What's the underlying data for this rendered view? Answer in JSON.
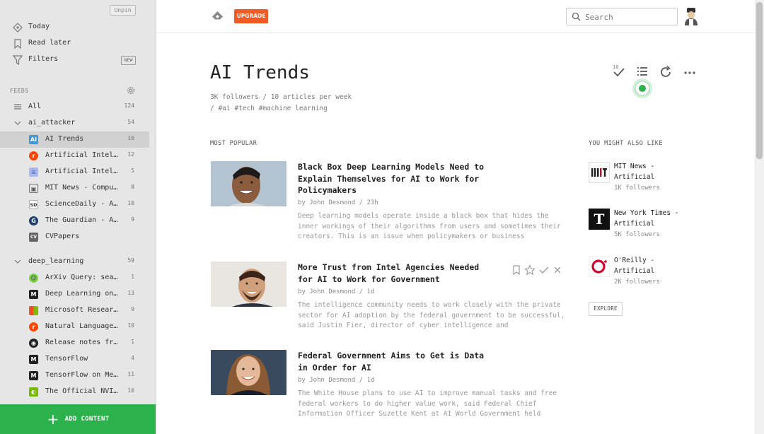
{
  "sidebar": {
    "unpin_label": "Unpin",
    "nav": [
      {
        "label": "Today",
        "icon": "today-icon"
      },
      {
        "label": "Read later",
        "icon": "bookmark-icon"
      },
      {
        "label": "Filters",
        "icon": "filter-icon",
        "badge": "NEW"
      }
    ],
    "feeds_label": "FEEDS",
    "all": {
      "label": "All",
      "count": "124"
    },
    "groups": [
      {
        "label": "ai_attacker",
        "count": "54",
        "items": [
          {
            "label": "AI Trends",
            "count": "10",
            "icon_color": "#3b9ad9",
            "icon_text": "AI",
            "active": true
          },
          {
            "label": "Artificial Intel…",
            "count": "12",
            "icon_color": "#ff4500",
            "icon_text": "r"
          },
          {
            "label": "Artificial Intel…",
            "count": "5",
            "icon_color": "#a9b6f5",
            "icon_text": "≡"
          },
          {
            "label": "MIT News - Compu…",
            "count": "8",
            "icon_color": "#888888",
            "icon_text": "▣"
          },
          {
            "label": "ScienceDaily - A…",
            "count": "10",
            "icon_color": "#ffffff",
            "icon_text": "SD"
          },
          {
            "label": "The Guardian - A…",
            "count": "9",
            "icon_color": "#1c3e6e",
            "icon_text": "G"
          },
          {
            "label": "CVPapers",
            "count": "",
            "icon_color": "#666666",
            "icon_text": "CV"
          }
        ]
      },
      {
        "label": "deep_learning",
        "count": "59",
        "items": [
          {
            "label": "ArXiv Query: sea…",
            "count": "1",
            "icon_color": "#7bd44a",
            "icon_text": "☺"
          },
          {
            "label": "Deep Learning on…",
            "count": "13",
            "icon_color": "#222222",
            "icon_text": "M"
          },
          {
            "label": "Microsoft Resear…",
            "count": "9",
            "icon_color": "#f25022",
            "icon_text": "▦"
          },
          {
            "label": "Natural Language…",
            "count": "10",
            "icon_color": "#ff4500",
            "icon_text": "r"
          },
          {
            "label": "Release notes fr…",
            "count": "1",
            "icon_color": "#222222",
            "icon_text": "◉"
          },
          {
            "label": "TensorFlow",
            "count": "4",
            "icon_color": "#222222",
            "icon_text": "M"
          },
          {
            "label": "TensorFlow on Me…",
            "count": "11",
            "icon_color": "#222222",
            "icon_text": "M"
          },
          {
            "label": "The Official NVI…",
            "count": "10",
            "icon_color": "#76b900",
            "icon_text": "◐"
          }
        ]
      }
    ],
    "add_content_label": "ADD CONTENT"
  },
  "header": {
    "upgrade_label": "UPGRADE",
    "search_placeholder": "Search"
  },
  "feed": {
    "title": "AI Trends",
    "stats": "3K followers / 10 articles per week",
    "tags": " / #ai #tech #machine learning",
    "mark_read_count": "10"
  },
  "most_popular": {
    "label": "MOST POPULAR",
    "articles": [
      {
        "title": "Black Box Deep Learning Models Need to Explain Themselves for AI to Work for Policymakers",
        "byline": "by John Desmond / 23h",
        "summary": "Deep learning models operate inside a black box that hides the inner workings of their algorithms from users and sometimes their creators. This is an issue when policymakers or business"
      },
      {
        "title": "More Trust from Intel Agencies Needed for AI to Work for Government",
        "byline": "by John Desmond / 1d",
        "summary": "The intelligence community needs to work closely with the private sector for AI adoption by the federal government to be successful, said Justin Fier, director of cyber intelligence and"
      },
      {
        "title": "Federal Government Aims to Get is Data in Order for AI",
        "byline": "by John Desmond / 1d",
        "summary": "The White House plans to use AI to improve manual tasks and free federal workers to do higher value work, said Federal Chief Information Officer Suzette Kent at AI World Government held"
      }
    ]
  },
  "suggestions": {
    "label": "YOU MIGHT ALSO LIKE",
    "items": [
      {
        "name": "MIT News - Artificial",
        "followers": "1K followers"
      },
      {
        "name": "New York Times - Artificial",
        "followers": "5K followers"
      },
      {
        "name": "O'Reilly - Artificial",
        "followers": "2K followers"
      }
    ],
    "explore_label": "EXPLORE"
  }
}
